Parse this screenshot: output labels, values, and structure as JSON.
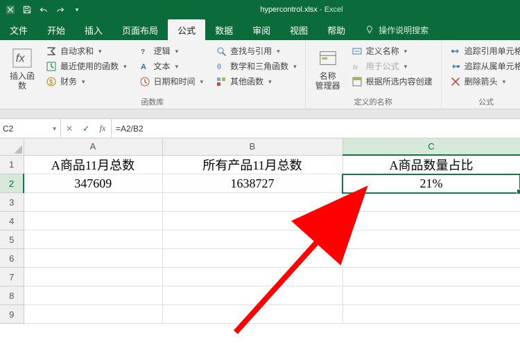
{
  "title": {
    "filename": "hypercontrol.xlsx",
    "app": "Excel"
  },
  "tabs": {
    "items": [
      "文件",
      "开始",
      "插入",
      "页面布局",
      "公式",
      "数据",
      "审阅",
      "视图",
      "帮助"
    ],
    "active_index": 4,
    "tell_me": "操作说明搜索"
  },
  "ribbon": {
    "insert_fn": "插入函数",
    "lib": {
      "autosum": "自动求和",
      "recent": "最近使用的函数",
      "financial": "财务",
      "logical": "逻辑",
      "text": "文本",
      "date": "日期和时间",
      "lookup": "查找与引用",
      "math": "数学和三角函数",
      "more": "其他函数",
      "label": "函数库"
    },
    "names": {
      "manager": "名称\n管理器",
      "define": "定义名称",
      "use": "用于公式",
      "create": "根据所选内容创建",
      "label": "定义的名称"
    },
    "audit": {
      "trace_prec": "追踪引用单元格",
      "trace_dep": "追踪从属单元格",
      "remove": "删除箭头",
      "label": "公式"
    }
  },
  "namebox": "C2",
  "formula": "=A2/B2",
  "columns": [
    "A",
    "B",
    "C"
  ],
  "rows": [
    "1",
    "2",
    "3",
    "4",
    "5",
    "6",
    "7",
    "8",
    "9"
  ],
  "cells": {
    "A1": "A商品11月总数",
    "B1": "所有产品11月总数",
    "C1": "A商品数量占比",
    "A2": "347609",
    "B2": "1638727",
    "C2": "21%"
  },
  "chart_data": {
    "type": "table",
    "title": "",
    "columns": [
      "A商品11月总数",
      "所有产品11月总数",
      "A商品数量占比"
    ],
    "rows": [
      {
        "A商品11月总数": 347609,
        "所有产品11月总数": 1638727,
        "A商品数量占比": "21%"
      }
    ],
    "formula": "=A2/B2",
    "active_cell": "C2"
  }
}
